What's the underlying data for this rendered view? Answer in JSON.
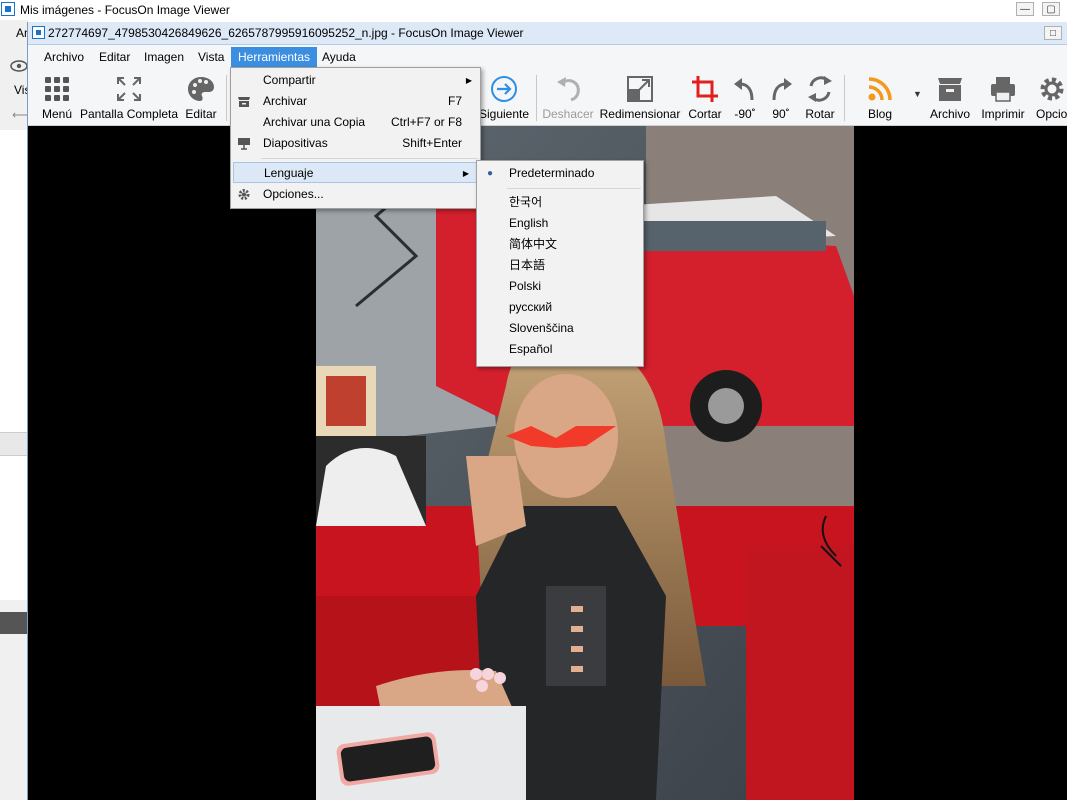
{
  "back_window": {
    "title": "Mis imágenes - FocusOn Image Viewer",
    "strip_labels": [
      "Ar",
      "Vis"
    ]
  },
  "front_window": {
    "title": "272774697_4798530426849626_6265787995916095252_n.jpg - FocusOn Image Viewer"
  },
  "menubar": {
    "items": [
      "Archivo",
      "Editar",
      "Imagen",
      "Vista",
      "Herramientas",
      "Ayuda"
    ],
    "active": "Herramientas"
  },
  "toolbar": {
    "menu": "Menú",
    "fullscreen": "Pantalla Completa",
    "edit": "Editar",
    "next": "Siguiente",
    "undo": "Deshacer",
    "resize": "Redimensionar",
    "crop": "Cortar",
    "rotate_left": "-90˚",
    "rotate_right": "90˚",
    "rotate": "Rotar",
    "blog": "Blog",
    "file": "Archivo",
    "print": "Imprimir",
    "options": "Opcio"
  },
  "tools_menu": {
    "items": [
      {
        "label": "Compartir",
        "shortcut": "",
        "submenu": true
      },
      {
        "label": "Archivar",
        "shortcut": "F7",
        "submenu": false
      },
      {
        "label": "Archivar una Copia",
        "shortcut": "Ctrl+F7 or F8",
        "submenu": false
      },
      {
        "label": "Diapositivas",
        "shortcut": "Shift+Enter",
        "submenu": false
      },
      {
        "label": "Lenguaje",
        "shortcut": "",
        "submenu": true
      },
      {
        "label": "Opciones...",
        "shortcut": "",
        "submenu": false
      }
    ]
  },
  "language_menu": {
    "selected": "Predeterminado",
    "items": [
      "Predeterminado",
      "한국어",
      "English",
      "简体中文",
      "日本語",
      "Polski",
      "русский",
      "Slovenščina",
      "Español"
    ]
  },
  "colors": {
    "accent": "#3b8ee0",
    "crop_red": "#e02020",
    "blog_orange": "#f39a1e"
  }
}
